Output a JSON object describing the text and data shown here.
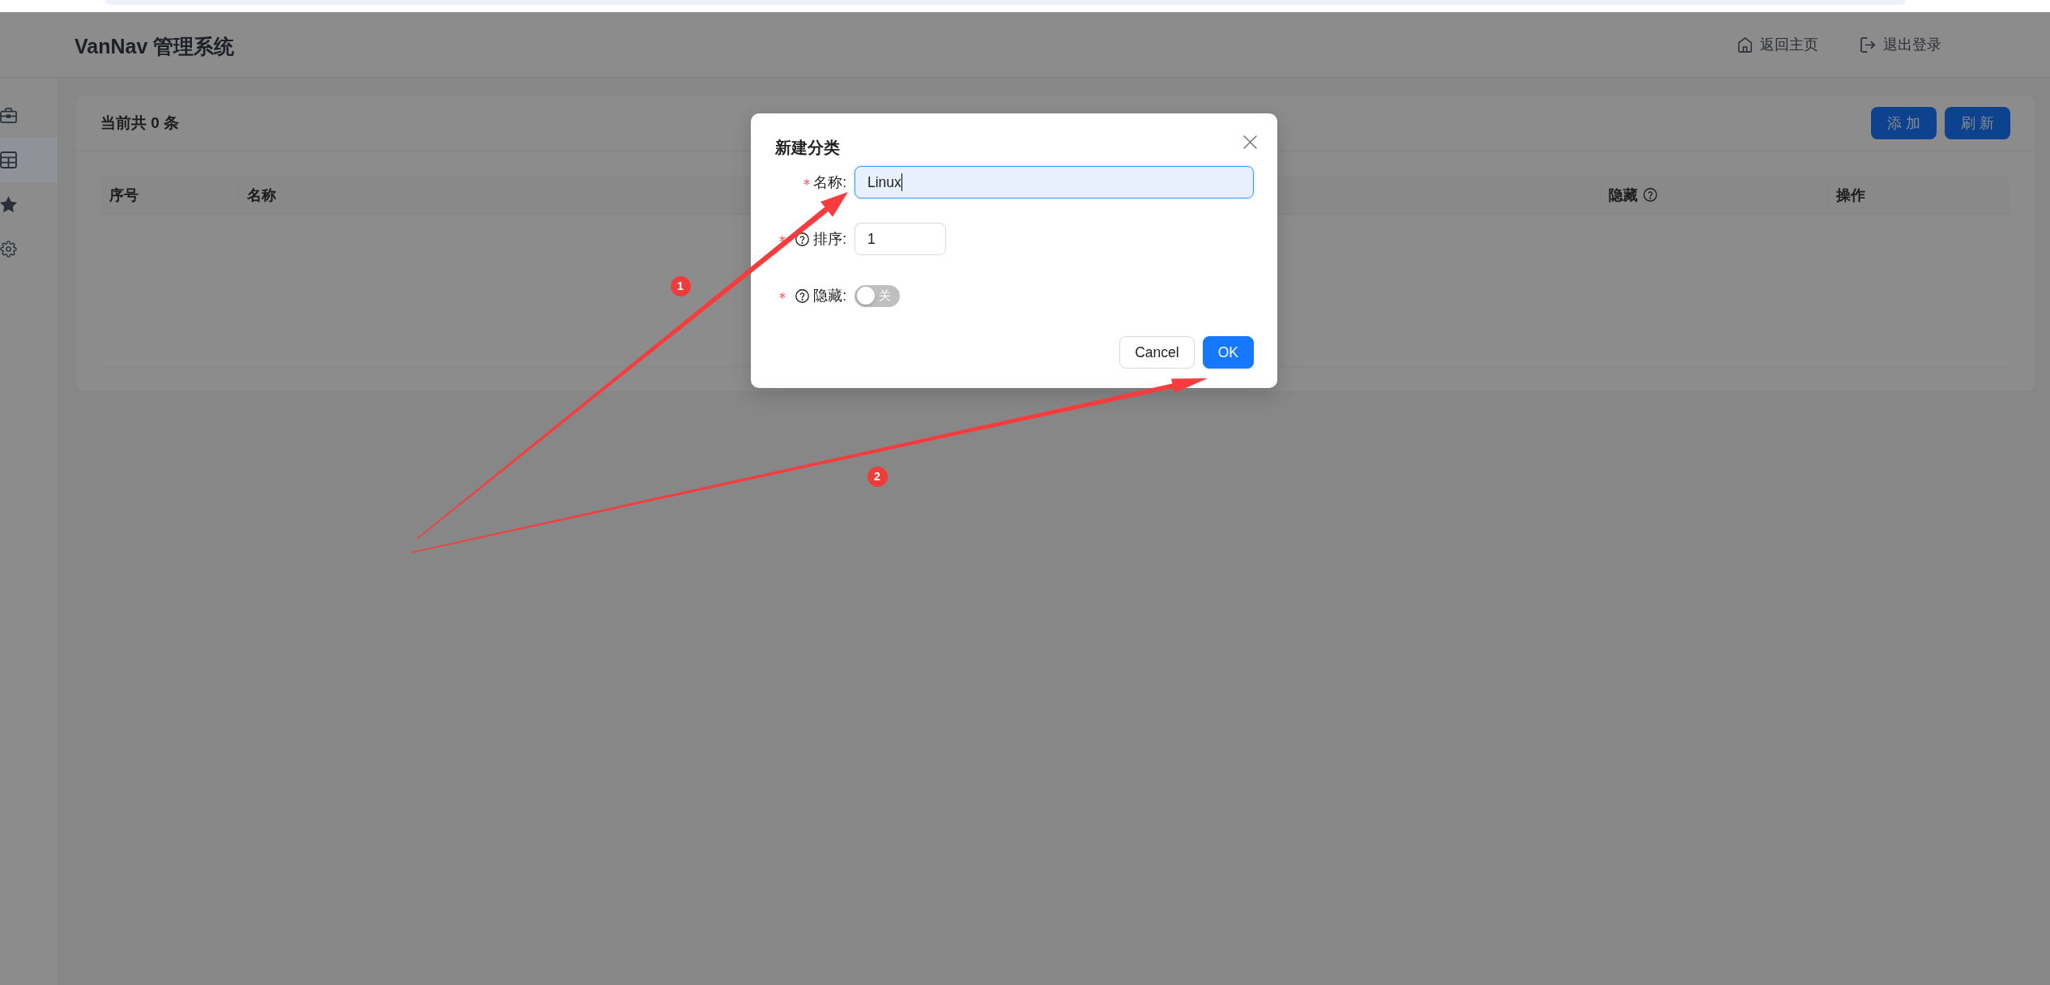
{
  "header": {
    "title": "VanNav 管理系统",
    "links": [
      {
        "label": "返回主页"
      },
      {
        "label": "退出登录"
      }
    ]
  },
  "sidebar": {
    "items": [
      {
        "selected": false
      },
      {
        "selected": true
      },
      {
        "selected": false
      },
      {
        "selected": false
      }
    ]
  },
  "card": {
    "title": "当前共 0 条",
    "buttons": [
      {
        "label": "添 加"
      },
      {
        "label": "刷 新"
      }
    ]
  },
  "table": {
    "columns": [
      {
        "label": "序号",
        "help": false
      },
      {
        "label": "名称",
        "help": false
      },
      {
        "label": "隐藏",
        "help": true
      },
      {
        "label": "操作",
        "help": false
      }
    ]
  },
  "dialog": {
    "title": "新建分类",
    "fields": [
      {
        "kind": "text",
        "label": "名称:",
        "required": true,
        "help": false,
        "value": "Linux",
        "focused": true
      },
      {
        "kind": "number",
        "label": "排序:",
        "required": true,
        "help": true,
        "value": "1",
        "focused": false
      },
      {
        "kind": "switch",
        "label": "隐藏:",
        "required": true,
        "help": true,
        "on": false,
        "switch_text": "关"
      }
    ],
    "buttons": [
      {
        "label": "Cancel",
        "kind": "default"
      },
      {
        "label": "OK",
        "kind": "primary"
      }
    ]
  },
  "annotations": [
    {
      "label": "1"
    },
    {
      "label": "2"
    }
  ]
}
